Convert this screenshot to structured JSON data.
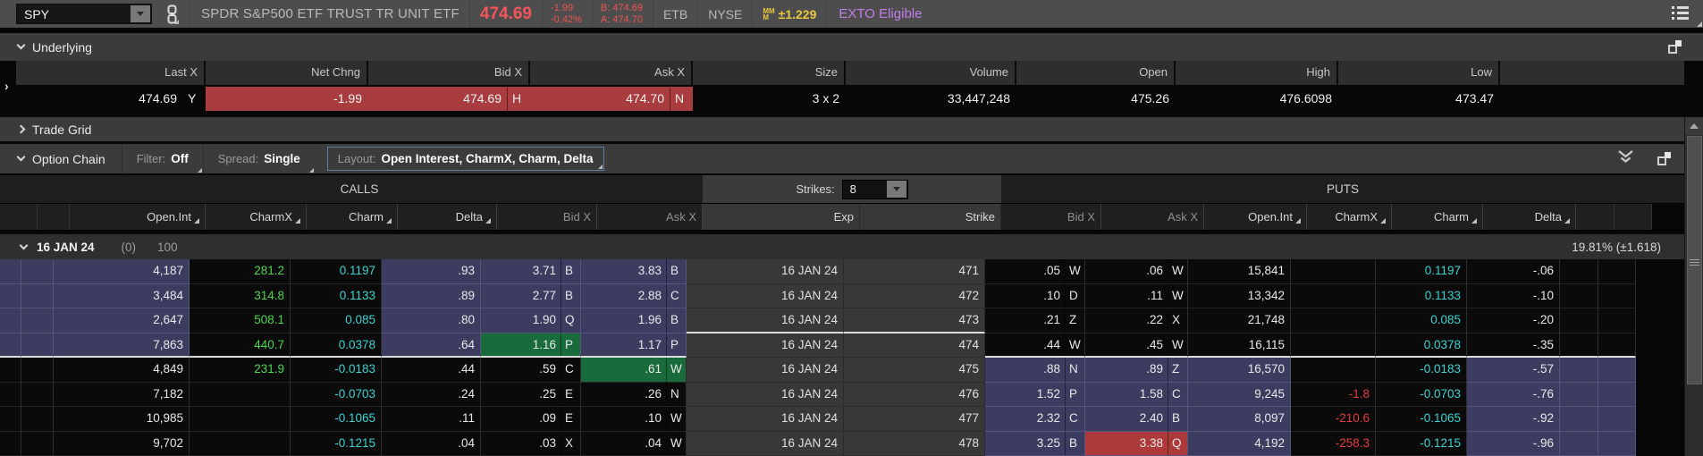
{
  "colors": {
    "price_red": "#f4555a",
    "down_red_bg": "#a93c3e",
    "highlight_green_bg": "#1a6b3c",
    "highlight_red_bg": "#ad3a3a",
    "itm_purple_bg": "#3c3c60",
    "charmx_green": "#4bd64b",
    "charm_cyan": "#3ad2d2",
    "charmx_red": "#e23d3d",
    "mm_yellow": "#e9c83f",
    "exto_purple": "#c17de9"
  },
  "icons": {
    "symbol_dropdown": "triangle-down",
    "link": "chain-link",
    "menu": "list-menu",
    "collapse_all": "double-chevron-down",
    "popout": "overlapping-squares",
    "expanded": "chevron-down",
    "collapsed": "chevron-right",
    "sort_mark": "corner-triangle",
    "scroll_up": "triangle-up"
  },
  "top_bar": {
    "symbol": "SPY",
    "description": "SPDR S&P500 ETF TRUST TR UNIT ETF",
    "last_price": "474.69",
    "net_change": "-1.99",
    "pct_change": "-0.42%",
    "bid_label": "B: 474.69",
    "ask_label": "A: 474.70",
    "etb": "ETB",
    "exchange": "NYSE",
    "mm_top": "MM",
    "mm_bottom": "M",
    "mm_move": "±1.229",
    "exto": "EXTO Eligible"
  },
  "underlying": {
    "title": "Underlying",
    "columns": [
      "Last X",
      "Net Chng",
      "Bid X",
      "Ask X",
      "Size",
      "Volume",
      "Open",
      "High",
      "Low"
    ],
    "values": [
      {
        "v": "474.69",
        "x": "Y"
      },
      {
        "v": "-1.99",
        "x": ""
      },
      {
        "v": "474.69",
        "x": "H"
      },
      {
        "v": "474.70",
        "x": "N"
      },
      {
        "v": "3 x 2",
        "x": ""
      },
      {
        "v": "33,447,248",
        "x": ""
      },
      {
        "v": "475.26",
        "x": ""
      },
      {
        "v": "476.6098",
        "x": ""
      },
      {
        "v": "473.47",
        "x": ""
      }
    ]
  },
  "trade_grid": {
    "title": "Trade Grid"
  },
  "option_chain": {
    "title": "Option Chain",
    "filter_label": "Filter:",
    "filter_value": "Off",
    "spread_label": "Spread:",
    "spread_value": "Single",
    "layout_label": "Layout:",
    "layout_value": "Open Interest, CharmX, Charm, Delta",
    "calls_header": "CALLS",
    "puts_header": "PUTS",
    "strikes_label": "Strikes:",
    "strikes_value": "8",
    "call_columns": [
      "Open.Int",
      "CharmX",
      "Charm",
      "Delta",
      "Bid X",
      "Ask X"
    ],
    "center_columns": [
      "Exp",
      "Strike"
    ],
    "put_columns": [
      "Bid X",
      "Ask X",
      "Open.Int",
      "CharmX",
      "Charm",
      "Delta"
    ],
    "group": {
      "expiry": "16 JAN 24",
      "days": "(0)",
      "multiplier": "100",
      "iv": "19.81% (±1.618)"
    },
    "rows": [
      {
        "strike": "471",
        "exp": "16 JAN 24",
        "call_itm": true,
        "put_itm": false,
        "call": {
          "oi": "4,187",
          "charmx": "281.2",
          "charm": "0.1197",
          "delta": ".93",
          "bid": "3.71",
          "bidx": "B",
          "ask": "3.83",
          "askx": "B"
        },
        "put": {
          "bid": ".05",
          "bidx": "W",
          "ask": ".06",
          "askx": "W",
          "oi": "15,841",
          "charmx": "",
          "charm": "0.1197",
          "delta": "-.06"
        }
      },
      {
        "strike": "472",
        "exp": "16 JAN 24",
        "call_itm": true,
        "put_itm": false,
        "call": {
          "oi": "3,484",
          "charmx": "314.8",
          "charm": "0.1133",
          "delta": ".89",
          "bid": "2.77",
          "bidx": "B",
          "ask": "2.88",
          "askx": "C"
        },
        "put": {
          "bid": ".10",
          "bidx": "D",
          "ask": ".11",
          "askx": "W",
          "oi": "13,342",
          "charmx": "",
          "charm": "0.1133",
          "delta": "-.10"
        }
      },
      {
        "strike": "473",
        "exp": "16 JAN 24",
        "call_itm": true,
        "put_itm": false,
        "center_line": true,
        "call": {
          "oi": "2,647",
          "charmx": "508.1",
          "charm": "0.085",
          "delta": ".80",
          "bid": "1.90",
          "bidx": "Q",
          "ask": "1.96",
          "askx": "B"
        },
        "put": {
          "bid": ".21",
          "bidx": "Z",
          "ask": ".22",
          "askx": "X",
          "oi": "21,748",
          "charmx": "",
          "charm": "0.085",
          "delta": "-.20"
        }
      },
      {
        "strike": "474",
        "exp": "16 JAN 24",
        "call_itm": true,
        "put_itm": false,
        "side_line": true,
        "call_bid_hl": "green",
        "call": {
          "oi": "7,863",
          "charmx": "440.7",
          "charm": "0.0378",
          "delta": ".64",
          "bid": "1.16",
          "bidx": "P",
          "ask": "1.17",
          "askx": "P"
        },
        "put": {
          "bid": ".44",
          "bidx": "W",
          "ask": ".45",
          "askx": "W",
          "oi": "16,115",
          "charmx": "",
          "charm": "0.0378",
          "delta": "-.35"
        }
      },
      {
        "strike": "475",
        "exp": "16 JAN 24",
        "call_itm": false,
        "put_itm": true,
        "call_ask_hl": "green",
        "call": {
          "oi": "4,849",
          "charmx": "231.9",
          "charm": "-0.0183",
          "delta": ".44",
          "bid": ".59",
          "bidx": "C",
          "ask": ".61",
          "askx": "W"
        },
        "put": {
          "bid": ".88",
          "bidx": "N",
          "ask": ".89",
          "askx": "Z",
          "oi": "16,570",
          "charmx": "",
          "charm": "-0.0183",
          "delta": "-.57"
        }
      },
      {
        "strike": "476",
        "exp": "16 JAN 24",
        "call_itm": false,
        "put_itm": true,
        "call": {
          "oi": "7,182",
          "charmx": "",
          "charm": "-0.0703",
          "delta": ".24",
          "bid": ".25",
          "bidx": "E",
          "ask": ".26",
          "askx": "N"
        },
        "put": {
          "bid": "1.52",
          "bidx": "P",
          "ask": "1.58",
          "askx": "C",
          "oi": "9,245",
          "charmx": "-1.8",
          "charm": "-0.0703",
          "delta": "-.76"
        }
      },
      {
        "strike": "477",
        "exp": "16 JAN 24",
        "call_itm": false,
        "put_itm": true,
        "call": {
          "oi": "10,985",
          "charmx": "",
          "charm": "-0.1065",
          "delta": ".11",
          "bid": ".09",
          "bidx": "E",
          "ask": ".10",
          "askx": "W"
        },
        "put": {
          "bid": "2.32",
          "bidx": "C",
          "ask": "2.40",
          "askx": "B",
          "oi": "8,097",
          "charmx": "-210.6",
          "charm": "-0.1065",
          "delta": "-.92"
        }
      },
      {
        "strike": "478",
        "exp": "16 JAN 24",
        "call_itm": false,
        "put_itm": true,
        "put_ask_hl": "red",
        "call": {
          "oi": "9,702",
          "charmx": "",
          "charm": "-0.1215",
          "delta": ".04",
          "bid": ".03",
          "bidx": "X",
          "ask": ".04",
          "askx": "W"
        },
        "put": {
          "bid": "3.25",
          "bidx": "B",
          "ask": "3.38",
          "askx": "Q",
          "oi": "4,192",
          "charmx": "-258.3",
          "charm": "-0.1215",
          "delta": "-.96"
        }
      }
    ]
  }
}
